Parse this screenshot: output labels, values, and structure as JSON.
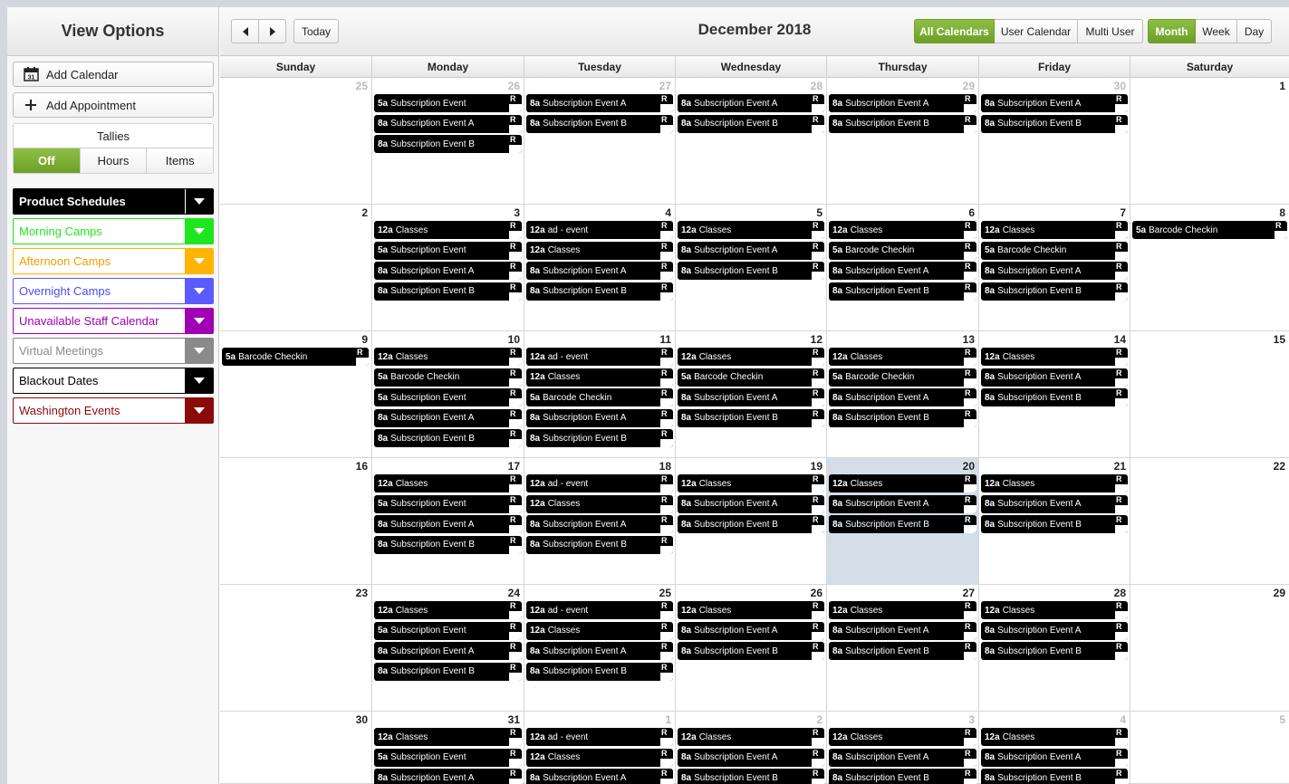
{
  "sidebar": {
    "title": "View Options",
    "add_calendar": "Add Calendar",
    "add_appointment": "Add Appointment",
    "tallies": {
      "title": "Tallies",
      "options": [
        "Off",
        "Hours",
        "Items"
      ],
      "selected": "Off"
    },
    "calendars": [
      {
        "label": "Product Schedules",
        "color": "#000000",
        "text_color": "#ffffff",
        "filled": true
      },
      {
        "label": "Morning Camps",
        "color": "#1ee61e",
        "text_color": "#1ee61e",
        "filled": false
      },
      {
        "label": "Afternoon Camps",
        "color": "#ffb400",
        "text_color": "#f0a000",
        "filled": false
      },
      {
        "label": "Overnight Camps",
        "color": "#5b5bff",
        "text_color": "#4d4dee",
        "filled": false
      },
      {
        "label": "Unavailable Staff Calendar",
        "color": "#a000b4",
        "text_color": "#a000b4",
        "filled": false
      },
      {
        "label": "Virtual Meetings",
        "color": "#8a8a8a",
        "text_color": "#8a8a8a",
        "filled": false
      },
      {
        "label": "Blackout Dates",
        "color": "#000000",
        "text_color": "#000000",
        "filled": false
      },
      {
        "label": "Washington Events",
        "color": "#8b0a0a",
        "text_color": "#8b0a0a",
        "filled": false
      }
    ]
  },
  "toolbar": {
    "today": "Today",
    "title": "December 2018",
    "calendar_views": [
      "All Calendars",
      "User Calendar",
      "Multi User"
    ],
    "calendar_view_selected": "All Calendars",
    "period_views": [
      "Month",
      "Week",
      "Day"
    ],
    "period_view_selected": "Month"
  },
  "days_of_week": [
    "Sunday",
    "Monday",
    "Tuesday",
    "Wednesday",
    "Thursday",
    "Friday",
    "Saturday"
  ],
  "recurring_marker": "R",
  "weeks": [
    [
      {
        "day": "25",
        "other": true,
        "events": []
      },
      {
        "day": "26",
        "other": true,
        "events": [
          [
            "5a",
            "Subscription Event"
          ],
          [
            "8a",
            "Subscription Event A"
          ],
          [
            "8a",
            "Subscription Event B"
          ]
        ]
      },
      {
        "day": "27",
        "other": true,
        "events": [
          [
            "8a",
            "Subscription Event A"
          ],
          [
            "8a",
            "Subscription Event B"
          ]
        ]
      },
      {
        "day": "28",
        "other": true,
        "events": [
          [
            "8a",
            "Subscription Event A"
          ],
          [
            "8a",
            "Subscription Event B"
          ]
        ]
      },
      {
        "day": "29",
        "other": true,
        "events": [
          [
            "8a",
            "Subscription Event A"
          ],
          [
            "8a",
            "Subscription Event B"
          ]
        ]
      },
      {
        "day": "30",
        "other": true,
        "events": [
          [
            "8a",
            "Subscription Event A"
          ],
          [
            "8a",
            "Subscription Event B"
          ]
        ]
      },
      {
        "day": "1",
        "events": []
      }
    ],
    [
      {
        "day": "2",
        "events": []
      },
      {
        "day": "3",
        "events": [
          [
            "12a",
            "Classes"
          ],
          [
            "5a",
            "Subscription Event"
          ],
          [
            "8a",
            "Subscription Event A"
          ],
          [
            "8a",
            "Subscription Event B"
          ]
        ]
      },
      {
        "day": "4",
        "events": [
          [
            "12a",
            "ad - event"
          ],
          [
            "12a",
            "Classes"
          ],
          [
            "8a",
            "Subscription Event A"
          ],
          [
            "8a",
            "Subscription Event B"
          ]
        ]
      },
      {
        "day": "5",
        "events": [
          [
            "12a",
            "Classes"
          ],
          [
            "8a",
            "Subscription Event A"
          ],
          [
            "8a",
            "Subscription Event B"
          ]
        ]
      },
      {
        "day": "6",
        "events": [
          [
            "12a",
            "Classes"
          ],
          [
            "5a",
            "Barcode Checkin"
          ],
          [
            "8a",
            "Subscription Event A"
          ],
          [
            "8a",
            "Subscription Event B"
          ]
        ]
      },
      {
        "day": "7",
        "events": [
          [
            "12a",
            "Classes"
          ],
          [
            "5a",
            "Barcode Checkin"
          ],
          [
            "8a",
            "Subscription Event A"
          ],
          [
            "8a",
            "Subscription Event B"
          ]
        ]
      },
      {
        "day": "8",
        "events": [
          [
            "5a",
            "Barcode Checkin"
          ]
        ]
      }
    ],
    [
      {
        "day": "9",
        "events": [
          [
            "5a",
            "Barcode Checkin"
          ]
        ]
      },
      {
        "day": "10",
        "events": [
          [
            "12a",
            "Classes"
          ],
          [
            "5a",
            "Barcode Checkin"
          ],
          [
            "5a",
            "Subscription Event"
          ],
          [
            "8a",
            "Subscription Event A"
          ],
          [
            "8a",
            "Subscription Event B"
          ]
        ]
      },
      {
        "day": "11",
        "events": [
          [
            "12a",
            "ad - event"
          ],
          [
            "12a",
            "Classes"
          ],
          [
            "5a",
            "Barcode Checkin"
          ],
          [
            "8a",
            "Subscription Event A"
          ],
          [
            "8a",
            "Subscription Event B"
          ]
        ]
      },
      {
        "day": "12",
        "events": [
          [
            "12a",
            "Classes"
          ],
          [
            "5a",
            "Barcode Checkin"
          ],
          [
            "8a",
            "Subscription Event A"
          ],
          [
            "8a",
            "Subscription Event B"
          ]
        ]
      },
      {
        "day": "13",
        "events": [
          [
            "12a",
            "Classes"
          ],
          [
            "5a",
            "Barcode Checkin"
          ],
          [
            "8a",
            "Subscription Event A"
          ],
          [
            "8a",
            "Subscription Event B"
          ]
        ]
      },
      {
        "day": "14",
        "events": [
          [
            "12a",
            "Classes"
          ],
          [
            "8a",
            "Subscription Event A"
          ],
          [
            "8a",
            "Subscription Event B"
          ]
        ]
      },
      {
        "day": "15",
        "events": []
      }
    ],
    [
      {
        "day": "16",
        "events": []
      },
      {
        "day": "17",
        "events": [
          [
            "12a",
            "Classes"
          ],
          [
            "5a",
            "Subscription Event"
          ],
          [
            "8a",
            "Subscription Event A"
          ],
          [
            "8a",
            "Subscription Event B"
          ]
        ]
      },
      {
        "day": "18",
        "events": [
          [
            "12a",
            "ad - event"
          ],
          [
            "12a",
            "Classes"
          ],
          [
            "8a",
            "Subscription Event A"
          ],
          [
            "8a",
            "Subscription Event B"
          ]
        ]
      },
      {
        "day": "19",
        "events": [
          [
            "12a",
            "Classes"
          ],
          [
            "8a",
            "Subscription Event A"
          ],
          [
            "8a",
            "Subscription Event B"
          ]
        ]
      },
      {
        "day": "20",
        "today": true,
        "events": [
          [
            "12a",
            "Classes"
          ],
          [
            "8a",
            "Subscription Event A"
          ],
          [
            "8a",
            "Subscription Event B"
          ]
        ]
      },
      {
        "day": "21",
        "events": [
          [
            "12a",
            "Classes"
          ],
          [
            "8a",
            "Subscription Event A"
          ],
          [
            "8a",
            "Subscription Event B"
          ]
        ]
      },
      {
        "day": "22",
        "events": []
      }
    ],
    [
      {
        "day": "23",
        "events": []
      },
      {
        "day": "24",
        "events": [
          [
            "12a",
            "Classes"
          ],
          [
            "5a",
            "Subscription Event"
          ],
          [
            "8a",
            "Subscription Event A"
          ],
          [
            "8a",
            "Subscription Event B"
          ]
        ]
      },
      {
        "day": "25",
        "events": [
          [
            "12a",
            "ad - event"
          ],
          [
            "12a",
            "Classes"
          ],
          [
            "8a",
            "Subscription Event A"
          ],
          [
            "8a",
            "Subscription Event B"
          ]
        ]
      },
      {
        "day": "26",
        "events": [
          [
            "12a",
            "Classes"
          ],
          [
            "8a",
            "Subscription Event A"
          ],
          [
            "8a",
            "Subscription Event B"
          ]
        ]
      },
      {
        "day": "27",
        "events": [
          [
            "12a",
            "Classes"
          ],
          [
            "8a",
            "Subscription Event A"
          ],
          [
            "8a",
            "Subscription Event B"
          ]
        ]
      },
      {
        "day": "28",
        "events": [
          [
            "12a",
            "Classes"
          ],
          [
            "8a",
            "Subscription Event A"
          ],
          [
            "8a",
            "Subscription Event B"
          ]
        ]
      },
      {
        "day": "29",
        "events": []
      }
    ],
    [
      {
        "day": "30",
        "events": []
      },
      {
        "day": "31",
        "events": [
          [
            "12a",
            "Classes"
          ],
          [
            "5a",
            "Subscription Event"
          ],
          [
            "8a",
            "Subscription Event A"
          ]
        ]
      },
      {
        "day": "1",
        "other": true,
        "events": [
          [
            "12a",
            "ad - event"
          ],
          [
            "12a",
            "Classes"
          ],
          [
            "8a",
            "Subscription Event A"
          ]
        ]
      },
      {
        "day": "2",
        "other": true,
        "events": [
          [
            "12a",
            "Classes"
          ],
          [
            "8a",
            "Subscription Event A"
          ],
          [
            "8a",
            "Subscription Event B"
          ]
        ]
      },
      {
        "day": "3",
        "other": true,
        "events": [
          [
            "12a",
            "Classes"
          ],
          [
            "8a",
            "Subscription Event A"
          ],
          [
            "8a",
            "Subscription Event B"
          ]
        ]
      },
      {
        "day": "4",
        "other": true,
        "events": [
          [
            "12a",
            "Classes"
          ],
          [
            "8a",
            "Subscription Event A"
          ],
          [
            "8a",
            "Subscription Event B"
          ]
        ]
      },
      {
        "day": "5",
        "other": true,
        "events": []
      }
    ]
  ]
}
